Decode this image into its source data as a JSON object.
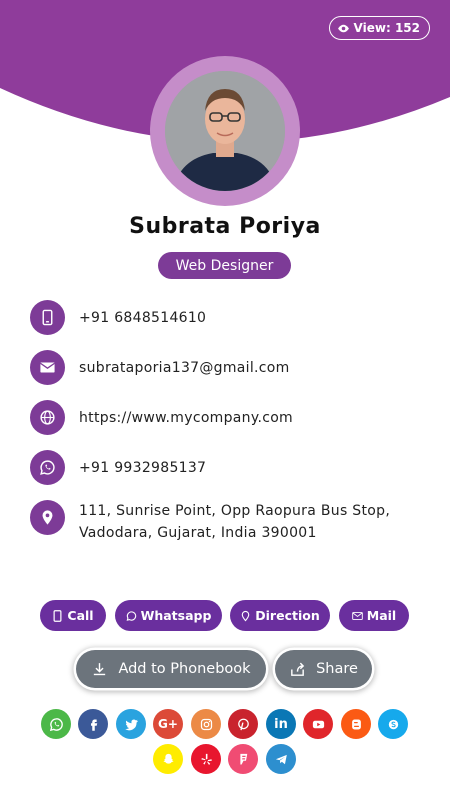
{
  "views": {
    "label": "View: 152"
  },
  "profile": {
    "name": "Subrata Poriya",
    "title": "Web Designer"
  },
  "contacts": [
    {
      "icon": "mobile-icon",
      "text": "+91 6848514610"
    },
    {
      "icon": "envelope-icon",
      "text": "subrataporia137@gmail.com"
    },
    {
      "icon": "globe-icon",
      "text": "https://www.mycompany.com"
    },
    {
      "icon": "whatsapp-icon",
      "text": "+91 9932985137"
    },
    {
      "icon": "location-pin-icon",
      "text": "111, Sunrise Point, Opp Raopura Bus Stop, Vadodara, Gujarat, India 390001"
    }
  ],
  "actions": {
    "call": "Call",
    "whatsapp": "Whatsapp",
    "direction": "Direction",
    "mail": "Mail"
  },
  "buttons": {
    "phonebook": "Add to Phonebook",
    "share": "Share"
  },
  "social": [
    {
      "name": "whatsapp",
      "color": "#4cb848"
    },
    {
      "name": "facebook",
      "color": "#3b5998"
    },
    {
      "name": "twitter",
      "color": "#2aa3df"
    },
    {
      "name": "google-plus",
      "color": "#dc4a38",
      "glyph": "G+"
    },
    {
      "name": "instagram",
      "color": "#ec8a46"
    },
    {
      "name": "pinterest",
      "color": "#c9232d"
    },
    {
      "name": "linkedin",
      "color": "#0a77b5",
      "glyph": "in"
    },
    {
      "name": "youtube",
      "color": "#e0262b"
    },
    {
      "name": "blogger",
      "color": "#fb5a14"
    },
    {
      "name": "skype",
      "color": "#16a9ec"
    },
    {
      "name": "snapchat",
      "color": "#ffec00"
    },
    {
      "name": "yelp",
      "color": "#e8162e"
    },
    {
      "name": "foursquare",
      "color": "#f04c73"
    },
    {
      "name": "telegram",
      "color": "#2d8fcf"
    }
  ],
  "colors": {
    "primary": "#7d3b97",
    "header": "#8f3c9b",
    "button": "#6a2f9e",
    "gray_button": "#6c747c"
  }
}
